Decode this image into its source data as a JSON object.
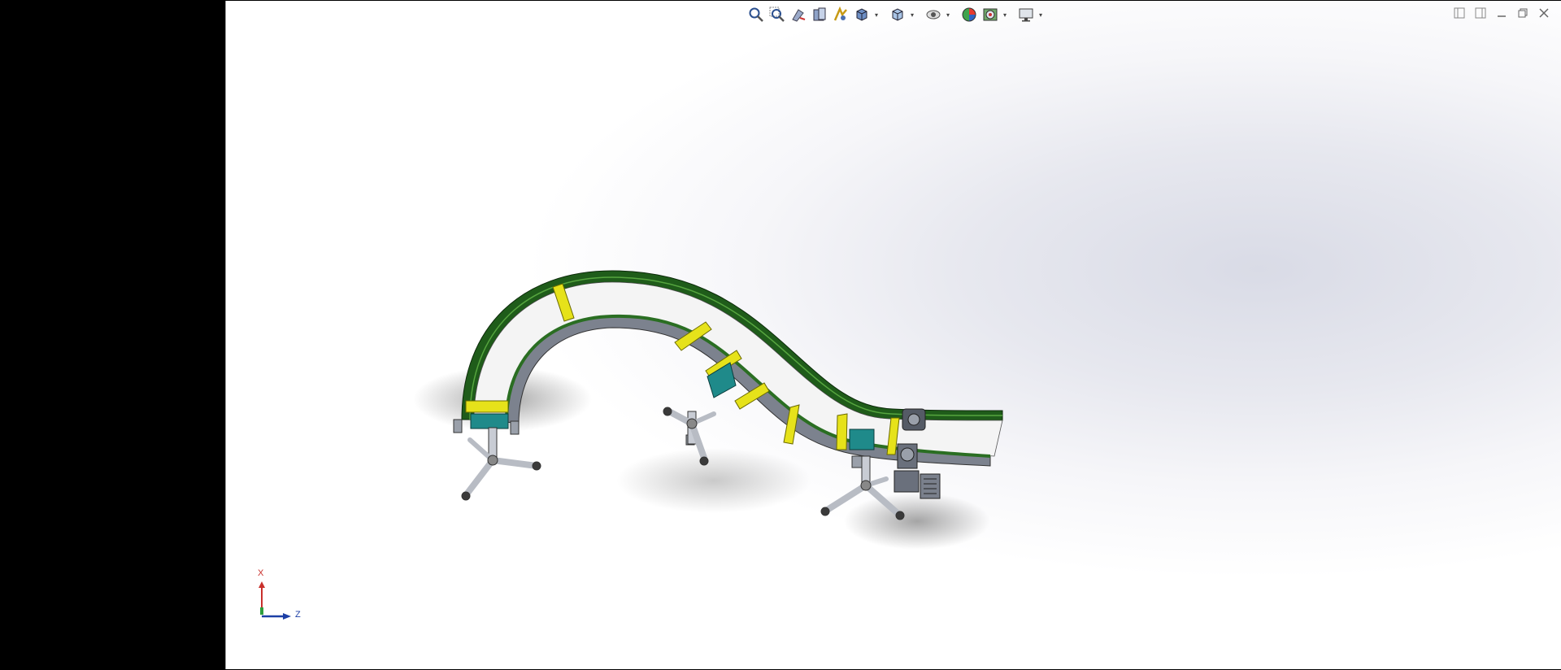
{
  "toolbar": {
    "items": [
      {
        "name": "zoom-to-fit-icon"
      },
      {
        "name": "zoom-to-area-icon"
      },
      {
        "name": "previous-view-icon"
      },
      {
        "name": "section-view-icon"
      },
      {
        "name": "dynamic-annotation-icon"
      },
      {
        "name": "view-orientation-icon",
        "caret": true
      },
      {
        "name": "display-style-icon",
        "caret": true
      },
      {
        "name": "hide-show-items-icon",
        "caret": true
      },
      {
        "name": "edit-appearance-icon"
      },
      {
        "name": "apply-scene-icon",
        "caret": true
      },
      {
        "name": "view-settings-icon",
        "caret": true
      }
    ]
  },
  "window_controls": [
    {
      "name": "tile-left-icon"
    },
    {
      "name": "tile-right-icon"
    },
    {
      "name": "minimize-icon"
    },
    {
      "name": "restore-icon"
    },
    {
      "name": "close-icon"
    }
  ],
  "triad": {
    "x_label": "X",
    "z_label": "Z"
  },
  "colors": {
    "belt_green": "#1f5c1a",
    "rail_yellow": "#e6e21a",
    "frame_grey": "#6e7480",
    "teal": "#1f8a8a",
    "background": "#ffffff"
  }
}
